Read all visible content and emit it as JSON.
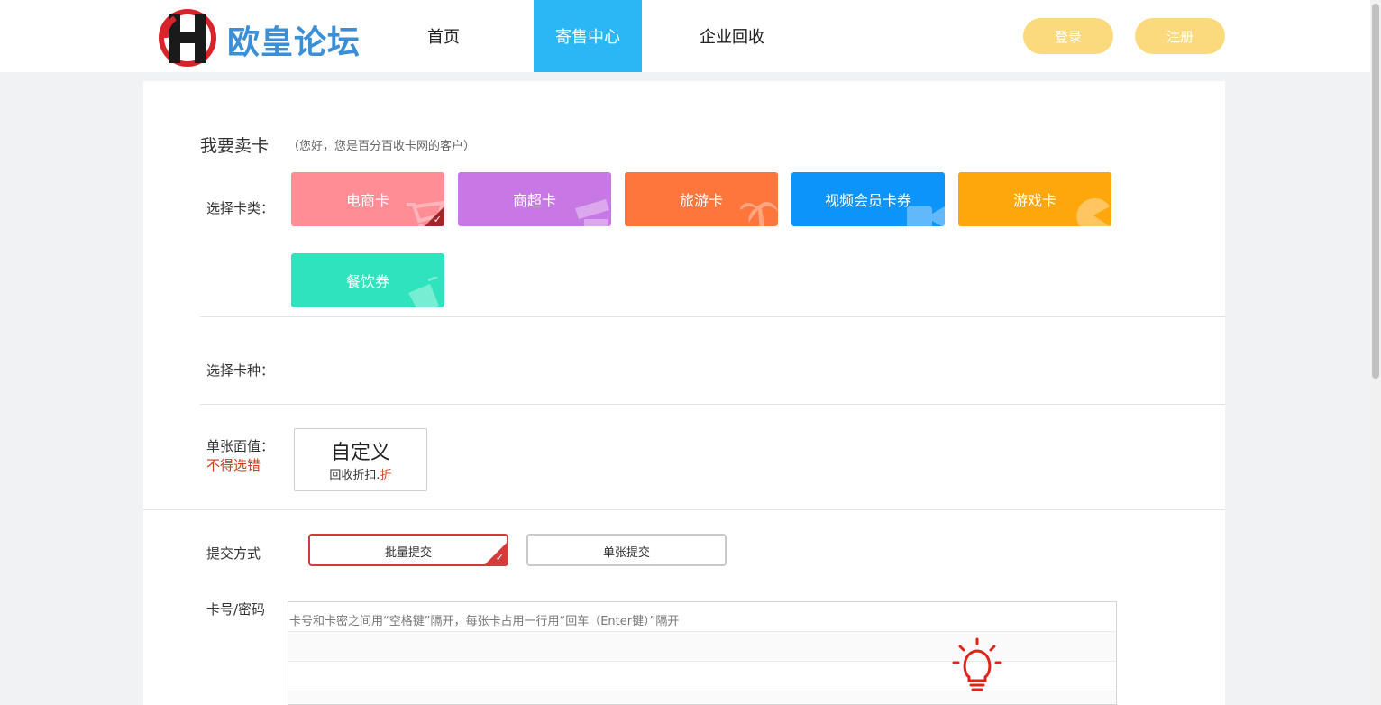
{
  "header": {
    "logo_text": "欧皇论坛",
    "nav": [
      {
        "label": "首页"
      },
      {
        "label": "寄售中心",
        "active": true
      },
      {
        "label": "企业回收"
      }
    ],
    "login_label": "登录",
    "register_label": "注册"
  },
  "sell": {
    "title": "我要卖卡",
    "subtitle": "（您好，您是百分百收卡网的客户）",
    "category_label": "选择卡类：",
    "categories": [
      {
        "label": "电商卡",
        "color": "#fe8d96",
        "icon": "shopping-cart-icon",
        "selected": true
      },
      {
        "label": "商超卡",
        "color": "#c878e4",
        "icon": "store-icon"
      },
      {
        "label": "旅游卡",
        "color": "#ff763d",
        "icon": "palm-tree-icon"
      },
      {
        "label": "视频会员卡券",
        "color": "#0d94fb",
        "icon": "video-play-icon"
      },
      {
        "label": "游戏卡",
        "color": "#fda70c",
        "icon": "pacman-icon"
      },
      {
        "label": "餐饮券",
        "color": "#2fe3be",
        "icon": "drink-cup-icon"
      }
    ],
    "kind_label": "选择卡种：",
    "face_value_label": "单张面值：",
    "face_value_warning": "不得选错",
    "custom_value": {
      "title": "自定义",
      "discount_prefix": "回收折扣.",
      "discount_suffix": "折"
    },
    "submit_method_label": "提交方式",
    "submit_methods": [
      {
        "label": "批量提交",
        "selected": true
      },
      {
        "label": "单张提交",
        "selected": false
      }
    ],
    "card_input_label": "卡号/密码",
    "card_input_placeholder": "卡号和卡密之间用“空格键”隔开，每张卡占用一行用“回车（Enter键）”隔开"
  },
  "colors": {
    "accent_nav": "#2bb6f5",
    "pill": "#fbd97d",
    "selected_border": "#d43a3a",
    "warning_text": "#d0401c"
  }
}
